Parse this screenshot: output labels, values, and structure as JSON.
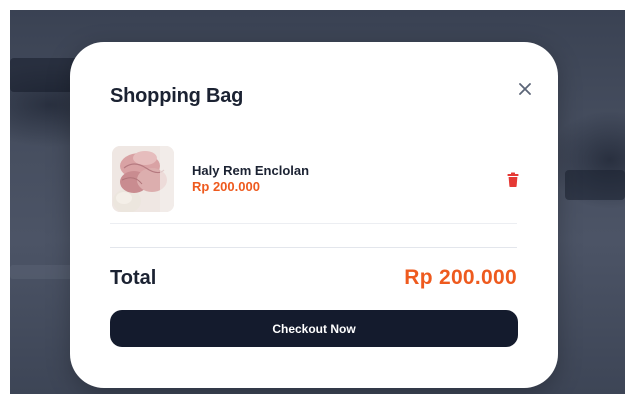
{
  "cart": {
    "title": "Shopping Bag",
    "close_icon": "close-icon",
    "items": [
      {
        "name": "Haly Rem Enclolan",
        "price": "Rp 200.000",
        "image": "pink-knit-fabric-thumbnail",
        "delete_icon": "trash-icon"
      }
    ],
    "total_label": "Total",
    "total_value": "Rp 200.000",
    "checkout_label": "Checkout Now"
  },
  "colors": {
    "accent": "#ee5a1e",
    "primary_dark": "#141b2d",
    "delete": "#e53935",
    "text": "#1b2232"
  }
}
